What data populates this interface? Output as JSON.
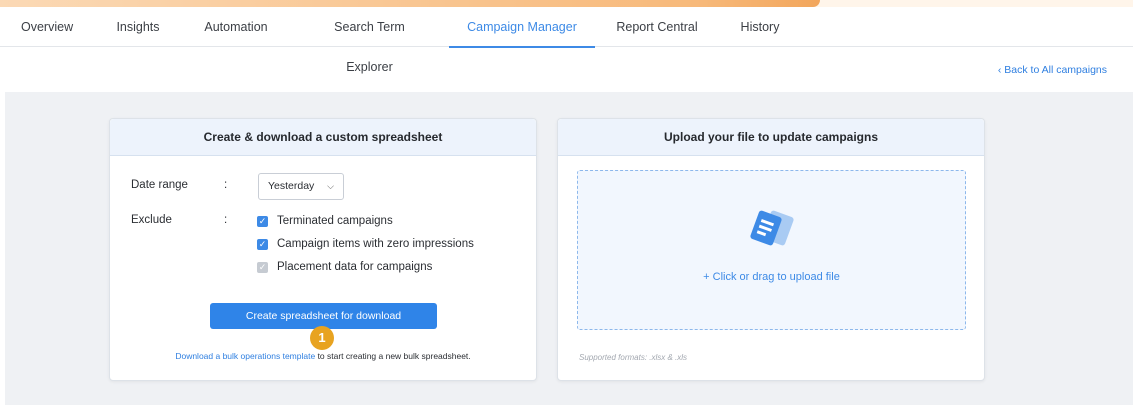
{
  "nav": {
    "tabs": [
      {
        "label": "Overview"
      },
      {
        "label": "Insights"
      },
      {
        "label": "Automation"
      },
      {
        "label": "Search Term Explorer"
      },
      {
        "label": "Campaign Manager"
      },
      {
        "label": "Report Central"
      },
      {
        "label": "History"
      }
    ],
    "active_tab": "Campaign Manager"
  },
  "back_link": "‹ Back to All campaigns",
  "create_card": {
    "title": "Create & download a custom spreadsheet",
    "date_range_label": "Date range",
    "colon": ":",
    "date_range_value": "Yesterday",
    "exclude_label": "Exclude",
    "exclude_options": [
      {
        "label": "Terminated campaigns",
        "checked": true
      },
      {
        "label": "Campaign items with zero impressions",
        "checked": true
      },
      {
        "label": "Placement data for campaigns",
        "checked": true,
        "disabled": true
      }
    ],
    "create_button": "Create spreadsheet for download",
    "template_link": "Download a bulk operations template",
    "template_suffix": " to start creating a new bulk spreadsheet."
  },
  "upload_card": {
    "title": "Upload your file to update campaigns",
    "dropzone_text": "+ Click or drag to upload file",
    "formats_note": "Supported formats: .xlsx & .xls"
  },
  "step_marker": "1",
  "colors": {
    "accent": "#3d8ae6",
    "marker": "#e8a320",
    "background": "#eff1f4"
  }
}
